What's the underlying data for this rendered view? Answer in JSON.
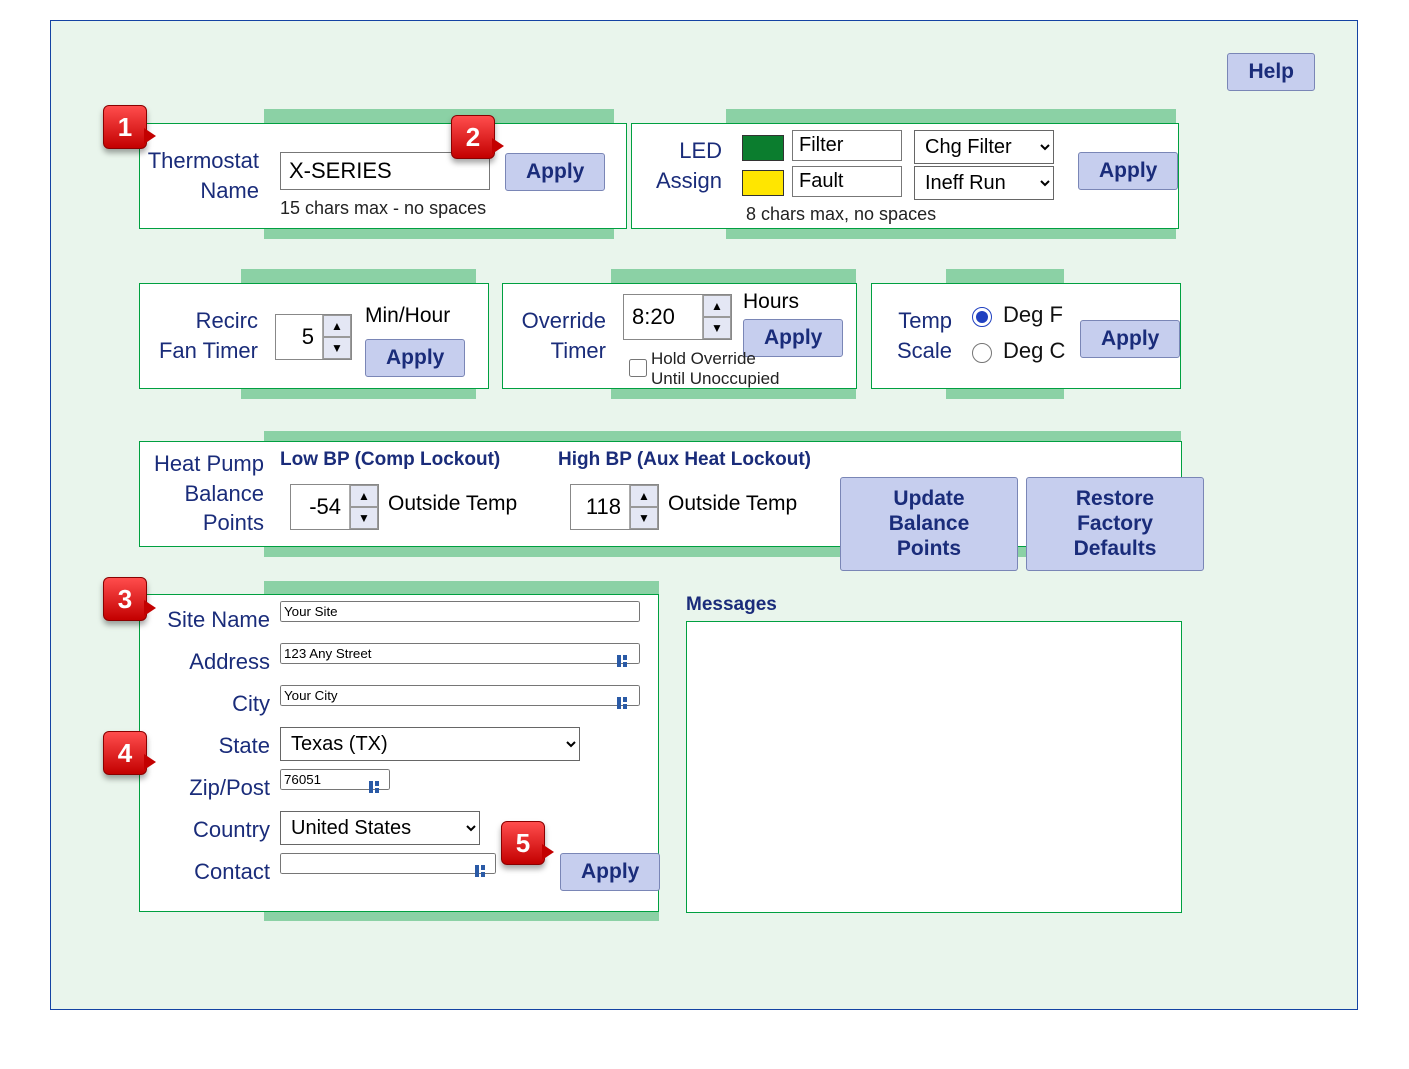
{
  "help_label": "Help",
  "apply_label": "Apply",
  "callouts": {
    "c1": "1",
    "c2": "2",
    "c3": "3",
    "c4": "4",
    "c5": "5"
  },
  "thermostat": {
    "label_l1": "Thermostat",
    "label_l2": "Name",
    "value": "X-SERIES",
    "hint": "15 chars max - no spaces"
  },
  "led": {
    "label_l1": "LED",
    "label_l2": "Assign",
    "row1": {
      "swatch": "#0b7d2e",
      "name": "Filter",
      "select": "Chg Filter"
    },
    "row2": {
      "swatch": "#ffe600",
      "name": "Fault",
      "select": "Ineff Run"
    },
    "hint": "8 chars max, no spaces"
  },
  "recirc": {
    "label_l1": "Recirc",
    "label_l2": "Fan Timer",
    "value": "5",
    "unit": "Min/Hour"
  },
  "override": {
    "label_l1": "Override",
    "label_l2": "Timer",
    "value": "8:20",
    "unit": "Hours",
    "hold_l1": "Hold Override",
    "hold_l2": "Until Unoccupied",
    "hold_checked": false
  },
  "tempscale": {
    "label_l1": "Temp",
    "label_l2": "Scale",
    "optF": "Deg F",
    "optC": "Deg C",
    "selected": "F"
  },
  "balance": {
    "label_l1": "Heat Pump",
    "label_l2": "Balance",
    "label_l3": "Points",
    "low_head": "Low BP (Comp Lockout)",
    "low_val": "-54",
    "low_unit": "Outside Temp",
    "high_head": "High BP (Aux Heat Lockout)",
    "high_val": "118",
    "high_unit": "Outside Temp",
    "update_l1": "Update Balance",
    "update_l2": "Points",
    "restore_l1": "Restore Factory",
    "restore_l2": "Defaults"
  },
  "site": {
    "name_label": "Site Name",
    "name": "Your Site",
    "address_label": "Address",
    "address": "123 Any Street",
    "city_label": "City",
    "city": "Your City",
    "state_label": "State",
    "state": "Texas (TX)",
    "zip_label": "Zip/Post",
    "zip": "76051",
    "country_label": "Country",
    "country": "United States",
    "contact_label": "Contact",
    "contact": ""
  },
  "messages_label": "Messages"
}
